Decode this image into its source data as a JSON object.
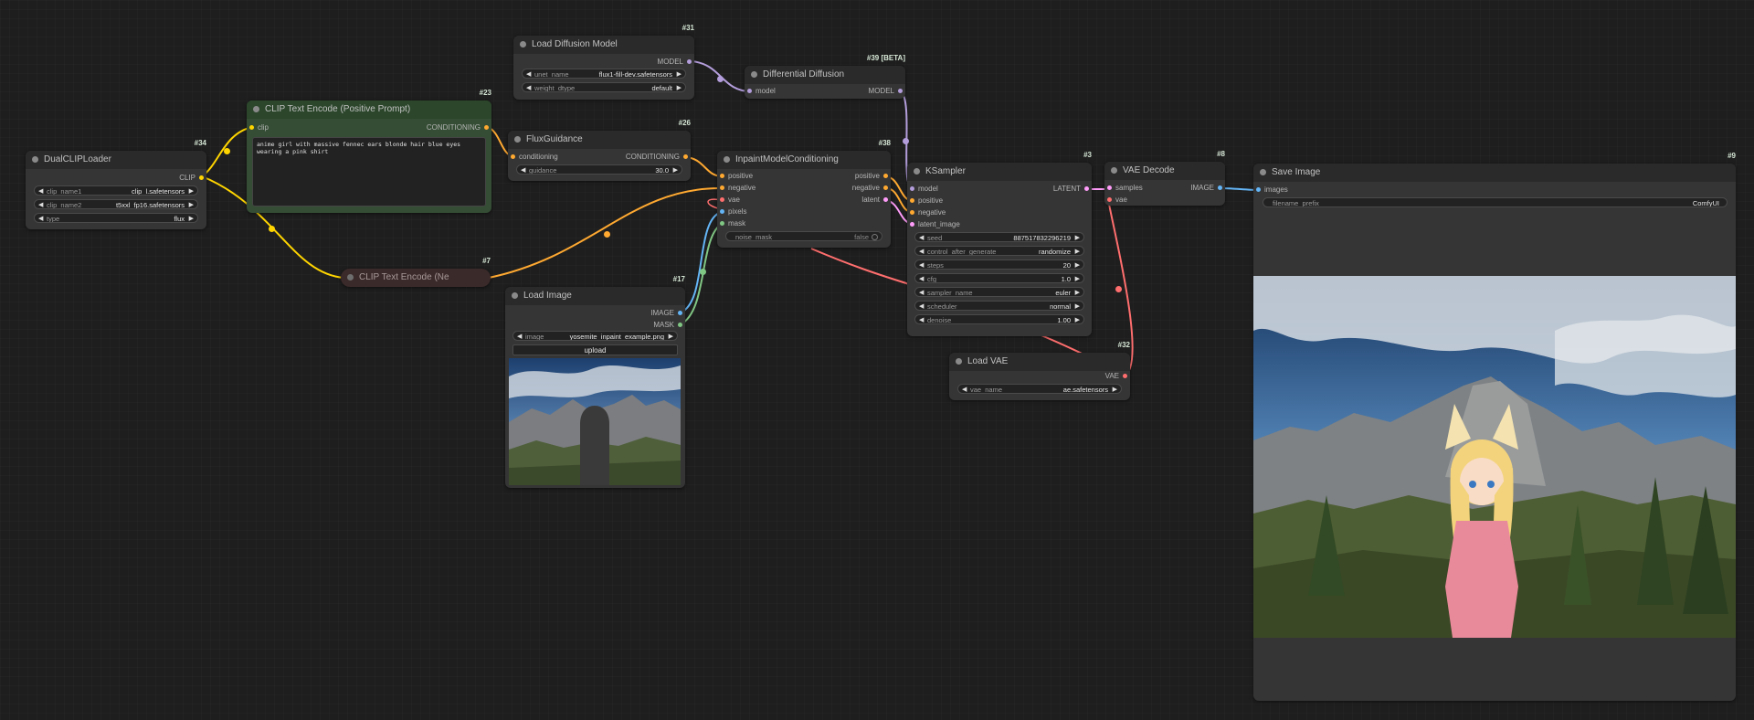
{
  "colors": {
    "clip": "#ffd500",
    "conditioning": "#ffa931",
    "model": "#b39ddb",
    "vae": "#ff6e6e",
    "latent": "#ff9cf9",
    "image": "#64b5f6",
    "mask": "#81c784",
    "positive_node_bg": "#344d34",
    "negative_node_bg": "#3b2a2a"
  },
  "nodes": {
    "dualclip": {
      "id": "#34",
      "title": "DualCLIPLoader",
      "out_clip": "CLIP",
      "w_clip_name1_label": "clip_name1",
      "w_clip_name1_value": "clip_l.safetensors",
      "w_clip_name2_label": "clip_name2",
      "w_clip_name2_value": "t5xxl_fp16.safetensors",
      "w_type_label": "type",
      "w_type_value": "flux"
    },
    "clip_pos": {
      "id": "#23",
      "title": "CLIP Text Encode (Positive Prompt)",
      "in_clip": "clip",
      "out_cond": "CONDITIONING",
      "text": "anime girl with massive fennec ears blonde hair blue eyes wearing a pink shirt"
    },
    "clip_neg": {
      "id": "#7",
      "title": "CLIP Text Encode (Ne"
    },
    "load_diff": {
      "id": "#31",
      "title": "Load Diffusion Model",
      "out_model": "MODEL",
      "w_unet_label": "unet_name",
      "w_unet_value": "flux1-fill-dev.safetensors",
      "w_dtype_label": "weight_dtype",
      "w_dtype_value": "default"
    },
    "diff_diff": {
      "id": "#39 [BETA]",
      "title": "Differential Diffusion",
      "in_model": "model",
      "out_model": "MODEL"
    },
    "flux_guid": {
      "id": "#26",
      "title": "FluxGuidance",
      "in_cond": "conditioning",
      "out_cond": "CONDITIONING",
      "w_guidance_label": "guidance",
      "w_guidance_value": "30.0"
    },
    "inpaint": {
      "id": "#38",
      "title": "InpaintModelConditioning",
      "in_positive": "positive",
      "in_negative": "negative",
      "in_vae": "vae",
      "in_pixels": "pixels",
      "in_mask": "mask",
      "out_positive": "positive",
      "out_negative": "negative",
      "out_latent": "latent",
      "w_noise_label": "noise_mask",
      "w_noise_value": "false"
    },
    "load_image": {
      "id": "#17",
      "title": "Load Image",
      "out_image": "IMAGE",
      "out_mask": "MASK",
      "w_image_label": "image",
      "w_image_value": "yosemite_inpaint_example.png",
      "upload": "upload"
    },
    "ksampler": {
      "id": "#3",
      "title": "KSampler",
      "in_model": "model",
      "in_positive": "positive",
      "in_negative": "negative",
      "in_latent": "latent_image",
      "out_latent": "LATENT",
      "widgets": [
        {
          "label": "seed",
          "value": "887517832296219"
        },
        {
          "label": "control_after_generate",
          "value": "randomize"
        },
        {
          "label": "steps",
          "value": "20"
        },
        {
          "label": "cfg",
          "value": "1.0"
        },
        {
          "label": "sampler_name",
          "value": "euler"
        },
        {
          "label": "scheduler",
          "value": "normal"
        },
        {
          "label": "denoise",
          "value": "1.00"
        }
      ]
    },
    "vae_decode": {
      "id": "#8",
      "title": "VAE Decode",
      "in_samples": "samples",
      "in_vae": "vae",
      "out_image": "IMAGE"
    },
    "load_vae": {
      "id": "#32",
      "title": "Load VAE",
      "out_vae": "VAE",
      "w_vae_label": "vae_name",
      "w_vae_value": "ae.safetensors"
    },
    "save_image": {
      "id": "#9",
      "title": "Save Image",
      "in_images": "images",
      "w_prefix_label": "filename_prefix",
      "w_prefix_value": "ComfyUI"
    }
  }
}
